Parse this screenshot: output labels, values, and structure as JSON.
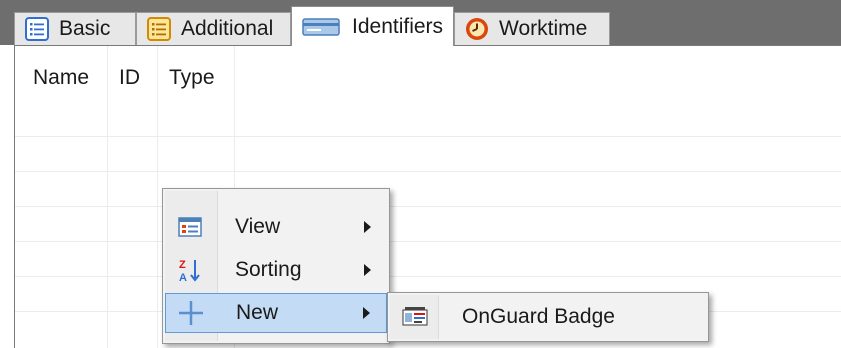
{
  "tabs": [
    {
      "label": "Basic",
      "icon": "list-icon"
    },
    {
      "label": "Additional",
      "icon": "list-yellow-icon"
    },
    {
      "label": "Identifiers",
      "icon": "card-icon",
      "active": true
    },
    {
      "label": "Worktime",
      "icon": "clock-icon"
    }
  ],
  "table": {
    "columns": [
      "Name",
      "ID",
      "Type"
    ]
  },
  "context_menu": {
    "items": [
      {
        "label": "View",
        "icon": "view-icon",
        "has_submenu": true
      },
      {
        "label": "Sorting",
        "icon": "sort-az-icon",
        "has_submenu": true
      },
      {
        "label": "New",
        "icon": "plus-icon",
        "has_submenu": true,
        "highlighted": true
      }
    ]
  },
  "submenu": {
    "items": [
      {
        "label": "OnGuard Badge",
        "icon": "badge-icon"
      }
    ]
  },
  "colors": {
    "tabbar_bg": "#6e6e6e",
    "highlight_bg": "#c3dbf4",
    "highlight_border": "#5e9bd8"
  }
}
